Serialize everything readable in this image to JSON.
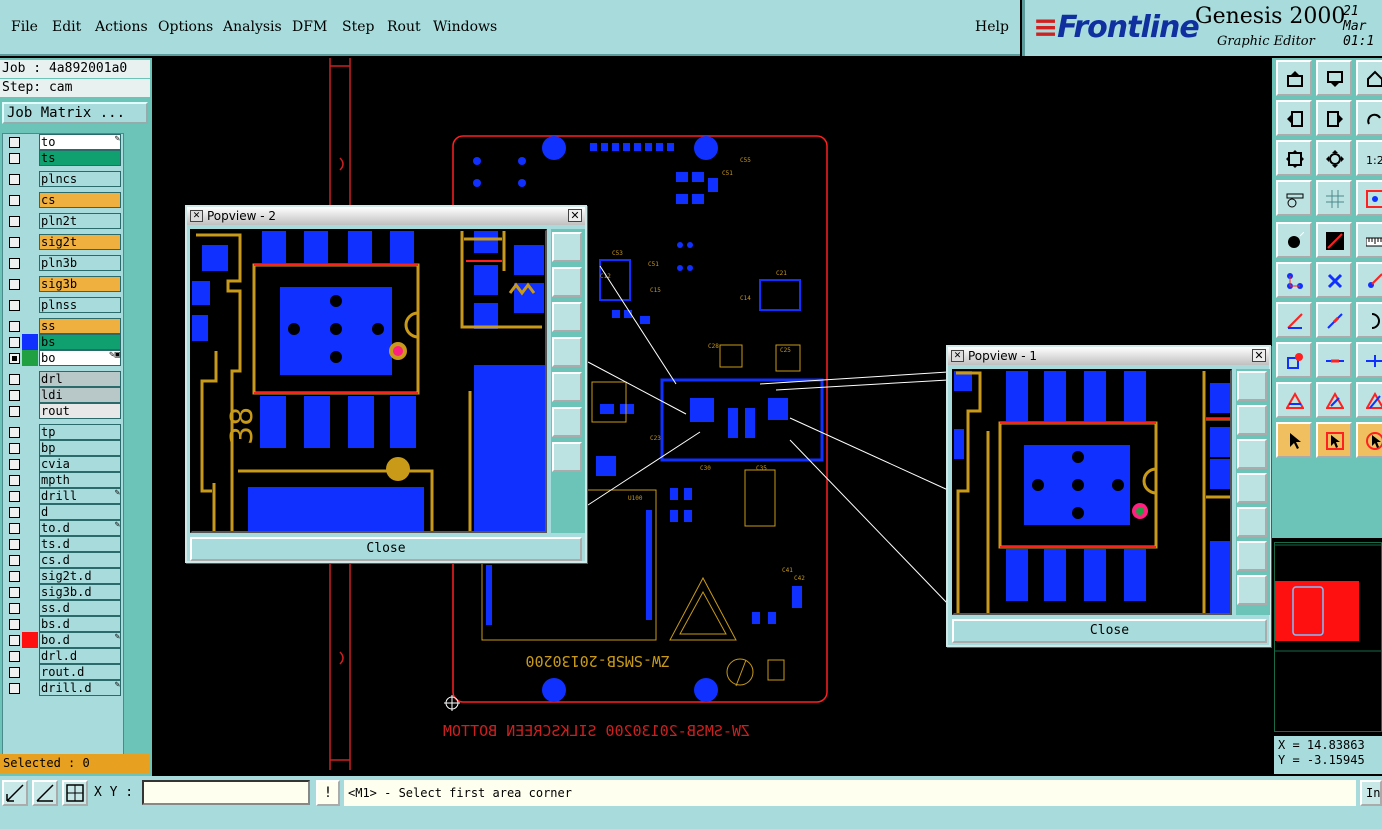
{
  "menubar": {
    "items": [
      "File",
      "Edit",
      "Actions",
      "Options",
      "Analysis",
      "DFM",
      "Step",
      "Rout",
      "Windows"
    ],
    "help": "Help"
  },
  "brand": {
    "logo": "Frontline",
    "product": "Genesis 2000",
    "subtitle": "Graphic Editor",
    "date": "21 Mar",
    "time": "01:1"
  },
  "job": {
    "job_line": "Job : 4a892001a0",
    "step_line": "Step: cam",
    "matrix_button": "Job Matrix ..."
  },
  "layers": [
    {
      "name": "to",
      "color": "#ffffff",
      "checked": false,
      "mark": "edit"
    },
    {
      "name": "ts",
      "color": "#10a070",
      "checked": false
    },
    {
      "name": "plncs",
      "color": "#a8dcdc",
      "checked": false
    },
    {
      "name": "cs",
      "color": "#f0b040",
      "checked": false
    },
    {
      "name": "pln2t",
      "color": "#a8dcdc",
      "checked": false
    },
    {
      "name": "sig2t",
      "color": "#f0b040",
      "checked": false
    },
    {
      "name": "pln3b",
      "color": "#a8dcdc",
      "checked": false
    },
    {
      "name": "sig3b",
      "color": "#f0b040",
      "checked": false
    },
    {
      "name": "plnss",
      "color": "#a8dcdc",
      "checked": false
    },
    {
      "name": "ss",
      "color": "#f0b040",
      "checked": false
    },
    {
      "name": "bs",
      "color": "#10a070",
      "checked": false,
      "swatch": "#1030ff"
    },
    {
      "name": "bo",
      "color": "#ffffff",
      "checked": true,
      "swatch": "#20a040",
      "mark": "edit-active"
    },
    {
      "name": "drl",
      "color": "#b8c8c8",
      "checked": false
    },
    {
      "name": "ldi",
      "color": "#b8c8c8",
      "checked": false
    },
    {
      "name": "rout",
      "color": "#e8e8e8",
      "checked": false
    },
    {
      "name": "tp",
      "color": "#a8dcdc",
      "checked": false
    },
    {
      "name": "bp",
      "color": "#a8dcdc",
      "checked": false
    },
    {
      "name": "cvia",
      "color": "#a8dcdc",
      "checked": false
    },
    {
      "name": "mpth",
      "color": "#a8dcdc",
      "checked": false
    },
    {
      "name": "drill",
      "color": "#a8dcdc",
      "checked": false,
      "mark": "edit"
    },
    {
      "name": "d",
      "color": "#a8dcdc",
      "checked": false
    },
    {
      "name": "to.d",
      "color": "#a8dcdc",
      "checked": false,
      "mark": "edit"
    },
    {
      "name": "ts.d",
      "color": "#a8dcdc",
      "checked": false
    },
    {
      "name": "cs.d",
      "color": "#a8dcdc",
      "checked": false
    },
    {
      "name": "sig2t.d",
      "color": "#a8dcdc",
      "checked": false
    },
    {
      "name": "sig3b.d",
      "color": "#a8dcdc",
      "checked": false
    },
    {
      "name": "ss.d",
      "color": "#a8dcdc",
      "checked": false
    },
    {
      "name": "bs.d",
      "color": "#a8dcdc",
      "checked": false
    },
    {
      "name": "bo.d",
      "color": "#a8dcdc",
      "checked": false,
      "swatch": "#ff1010",
      "mark": "edit"
    },
    {
      "name": "drl.d",
      "color": "#a8dcdc",
      "checked": false
    },
    {
      "name": "rout.d",
      "color": "#a8dcdc",
      "checked": false
    },
    {
      "name": "drill.d",
      "color": "#a8dcdc",
      "checked": false,
      "mark": "edit"
    }
  ],
  "status": {
    "selected": "Selected : 0",
    "xy_label": "X Y :",
    "xy_value": "",
    "warning_glyph": "!",
    "prompt": "<M1> - Select first area corner",
    "in_button": "In"
  },
  "coords": {
    "x": "X = 14.83863",
    "y": "Y = -3.15945"
  },
  "board": {
    "silkscreen_text": "ZW-SMSB-20130200",
    "bottom_label": "ZW-SMSB-20130200 SILKSCREEN BOTTOM",
    "pad_label": "38"
  },
  "popups": [
    {
      "title": "Popview - 2",
      "close_label": "Close"
    },
    {
      "title": "Popview - 1",
      "close_label": "Close"
    }
  ],
  "colors": {
    "panel": "#a8dcdc",
    "panel_dark": "#6cc4b8",
    "copper": "#1030ff",
    "silk": "#c89a18",
    "outline": "#ff2020"
  }
}
